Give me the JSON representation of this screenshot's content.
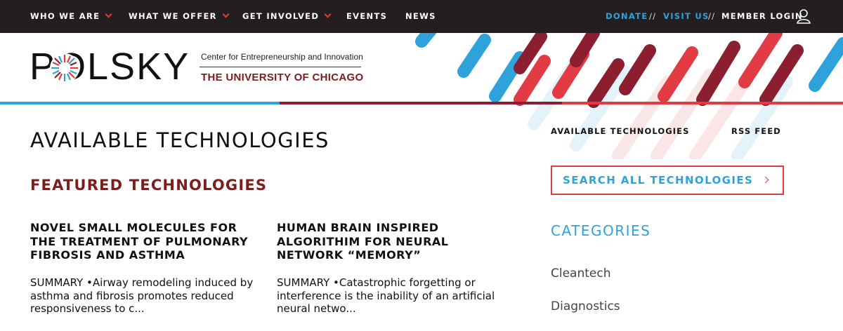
{
  "nav": {
    "items": [
      {
        "label": "WHO WE ARE"
      },
      {
        "label": "WHAT WE OFFER"
      },
      {
        "label": "GET INVOLVED"
      },
      {
        "label": "EVENTS"
      },
      {
        "label": "NEWS"
      }
    ],
    "donate": "DONATE",
    "visit": "VISIT US",
    "member_login": "MEMBER LOGIN",
    "separator": "//"
  },
  "header": {
    "logo_text": "POLSKY",
    "tagline": "Center for Entrepreneurship and Innovation",
    "university": "THE UNIVERSITY OF CHICAGO"
  },
  "main": {
    "title": "AVAILABLE TECHNOLOGIES",
    "featured_heading": "FEATURED TECHNOLOGIES",
    "cards": [
      {
        "title": "NOVEL SMALL MOLECULES FOR THE TREATMENT OF PULMONARY FIBROSIS AND ASTHMA",
        "summary": "SUMMARY •Airway remodeling induced by asthma and fibrosis promotes reduced responsiveness to c..."
      },
      {
        "title": "HUMAN BRAIN INSPIRED ALGORITHIM FOR NEURAL NETWORK “MEMORY”",
        "summary": "SUMMARY •Catastrophic forgetting or interference is the inability of an artificial neural netwo..."
      }
    ]
  },
  "sidebar": {
    "links": [
      {
        "label": "AVAILABLE TECHNOLOGIES"
      },
      {
        "label": "RSS FEED"
      }
    ],
    "search_label": "SEARCH ALL TECHNOLOGIES",
    "categories_title": "CATEGORIES",
    "categories": [
      {
        "label": "Cleantech"
      },
      {
        "label": "Diagnostics"
      }
    ]
  },
  "colors": {
    "nav_bg": "#231f20",
    "accent_blue": "#2ea3db",
    "accent_red": "#e23b44",
    "maroon": "#7a1e1e"
  }
}
